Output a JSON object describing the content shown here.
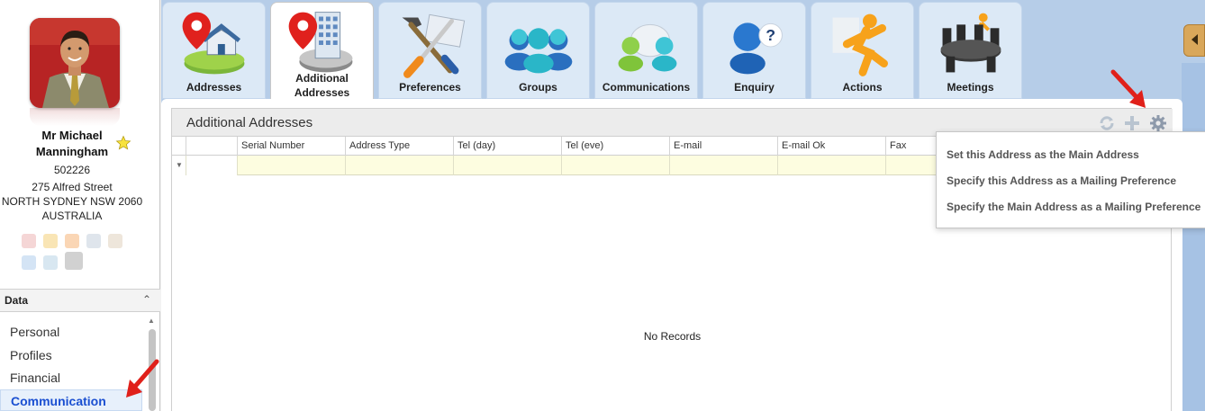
{
  "contact": {
    "name": "Mr Michael Manningham",
    "id": "502226",
    "street": "275 Alfred Street",
    "city_line": "NORTH SYDNEY NSW 2060",
    "country": "AUSTRALIA"
  },
  "data_section": {
    "title": "Data",
    "items": [
      {
        "label": "Personal"
      },
      {
        "label": "Profiles"
      },
      {
        "label": "Financial"
      },
      {
        "label": "Communication",
        "active": true
      }
    ]
  },
  "tabs": [
    {
      "label": "Addresses",
      "icon": "address-pin-house-icon"
    },
    {
      "label": "Additional Addresses",
      "icon": "additional-address-building-icon",
      "active": true
    },
    {
      "label": "Preferences",
      "icon": "tools-icon"
    },
    {
      "label": "Groups",
      "icon": "group-people-icon"
    },
    {
      "label": "Communications",
      "icon": "communications-people-icon"
    },
    {
      "label": "Enquiry",
      "icon": "enquiry-person-question-icon"
    },
    {
      "label": "Actions",
      "icon": "running-person-icon"
    },
    {
      "label": "Meetings",
      "icon": "meeting-table-icon"
    }
  ],
  "panel": {
    "title": "Additional Addresses",
    "actions": [
      "refresh-icon",
      "add-icon",
      "settings-gear-icon"
    ],
    "columns": [
      "Serial Number",
      "Address Type",
      "Tel (day)",
      "Tel (eve)",
      "E-mail",
      "E-mail Ok",
      "Fax"
    ],
    "empty_text": "No Records"
  },
  "menu": {
    "items": [
      "Set this Address as the Main Address",
      "Specify this Address as a Mailing Preference",
      "Specify the Main Address as a Mailing Preference"
    ]
  },
  "colors": {
    "accent_active_nav": "#1a4fd1",
    "tab_bg": "#dce9f6",
    "background": "#b6cde8",
    "filter_row": "#fdfde0",
    "annotation_arrow": "#e0201a"
  }
}
